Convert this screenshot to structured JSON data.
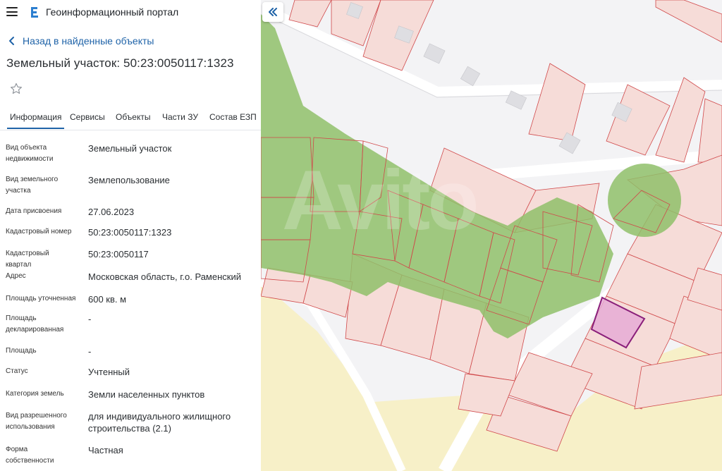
{
  "app": {
    "title": "Геоинформационный портал"
  },
  "nav": {
    "back_label": "Назад в найденные объекты"
  },
  "object": {
    "title": "Земельный участок: 50:23:0050117:1323"
  },
  "tabs": [
    {
      "label": "Информация",
      "active": true
    },
    {
      "label": "Сервисы"
    },
    {
      "label": "Объекты"
    },
    {
      "label": "Части ЗУ"
    },
    {
      "label": "Состав ЕЗП"
    }
  ],
  "fields": [
    {
      "label": "Вид объекта недвижимости",
      "value": "Земельный участок"
    },
    {
      "label": "Вид земельного участка",
      "value": "Землепользование"
    },
    {
      "label": "Дата присвоения",
      "value": "27.06.2023"
    },
    {
      "label": "Кадастровый номер",
      "value": "50:23:0050117:1323"
    },
    {
      "label": "Кадастровый квартал",
      "value": "50:23:0050117"
    },
    {
      "label": "Адрес",
      "value": "Московская область, г.о. Раменский"
    },
    {
      "label": "Площадь уточненная",
      "value": "600 кв. м"
    },
    {
      "label": "Площадь декларированная",
      "value": "-"
    },
    {
      "label": "Площадь",
      "value": "-"
    },
    {
      "label": "Статус",
      "value": "Учтенный"
    },
    {
      "label": "Категория земель",
      "value": "Земли населенных пунктов"
    },
    {
      "label": "Вид разрешенного использования",
      "value": "для индивидуального жилищного строительства (2.1)"
    },
    {
      "label": "Форма собственности",
      "value": "Частная"
    }
  ],
  "watermark": {
    "text": "Avito"
  },
  "colors": {
    "accent": "#1f63a8",
    "parcel_fill": "#f6dcd8",
    "parcel_stroke": "#d0484a",
    "forest": "#8fc06a",
    "field": "#f7f0c8",
    "selected_fill": "#e6a9d6",
    "selected_stroke": "#8a1f7a"
  }
}
